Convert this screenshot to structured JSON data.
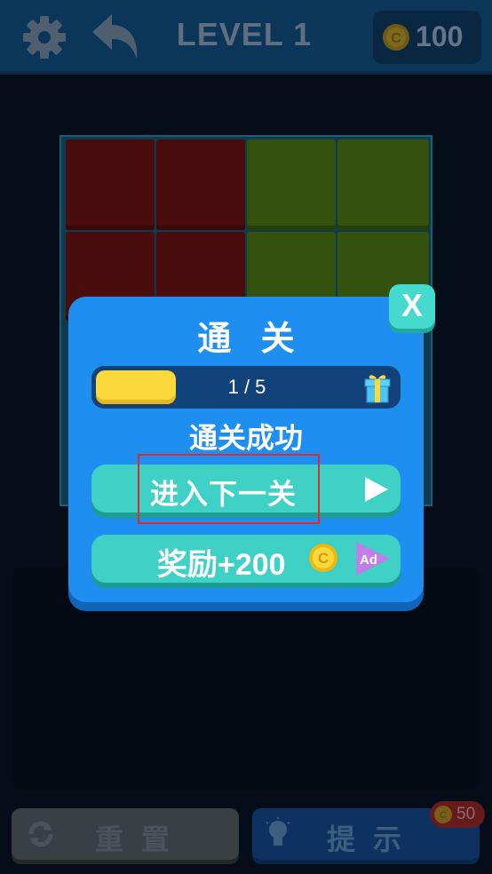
{
  "header": {
    "settings_icon": "gear-icon",
    "back_icon": "undo-arrow-icon",
    "level_title": "LEVEL 1",
    "coin_icon": "coin-icon",
    "coins": "100"
  },
  "board": {
    "tile_colors": {
      "red": "#4a0d0e",
      "green": "#33520d"
    }
  },
  "modal": {
    "title": "通 关",
    "progress_text": "1 / 5",
    "progress_fraction": 0.2,
    "gift_icon": "gift-icon",
    "success_text": "通关成功",
    "next_label": "进入下一关",
    "next_icon": "play-icon",
    "reward_label": "奖励+200",
    "reward_coin_icon": "coin-icon",
    "ad_icon": "ad-play-icon",
    "close_label": "X"
  },
  "footer": {
    "reset_label": "重置",
    "reset_icon": "refresh-icon",
    "hint_label": "提示",
    "hint_icon": "lightbulb-icon",
    "hint_cost": "50"
  },
  "colors": {
    "modal_bg": "#1e8ff0",
    "teal_button": "#3fd1c5",
    "progress_fill": "#fbd93a",
    "highlight": "#e02a2a"
  }
}
